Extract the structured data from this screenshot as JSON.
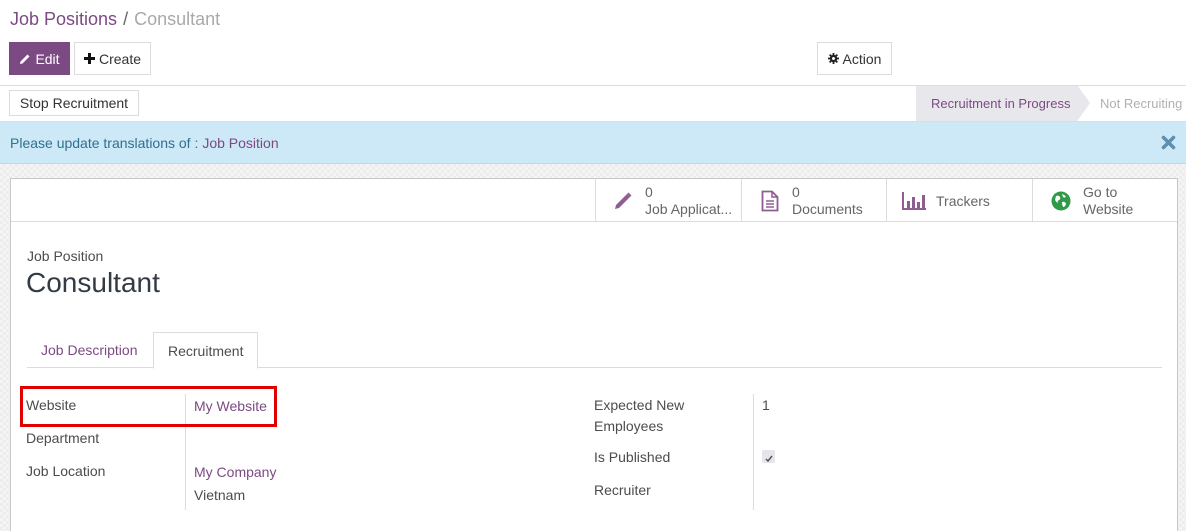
{
  "breadcrumb": {
    "parent": "Job Positions",
    "separator": "/",
    "current": "Consultant"
  },
  "toolbar": {
    "edit_label": "Edit",
    "create_label": "Create",
    "action_label": "Action"
  },
  "statusbar": {
    "stop_label": "Stop Recruitment",
    "stages": [
      {
        "label": "Recruitment in Progress",
        "active": true
      },
      {
        "label": "Not Recruiting",
        "active": false
      }
    ]
  },
  "alert": {
    "text": "Please update translations of :",
    "link": "Job Position"
  },
  "smart_buttons": [
    {
      "icon": "pencil-icon",
      "value": "0",
      "label": "Job Applicat..."
    },
    {
      "icon": "document-icon",
      "value": "0",
      "label": "Documents"
    },
    {
      "icon": "bar-chart-icon",
      "label": "Trackers"
    },
    {
      "icon": "globe-icon",
      "line1": "Go to",
      "line2": "Website"
    }
  ],
  "record": {
    "label": "Job Position",
    "name": "Consultant"
  },
  "tabs": [
    {
      "label": "Job Description",
      "active": false
    },
    {
      "label": "Recruitment",
      "active": true
    }
  ],
  "fields_left": {
    "website": {
      "label": "Website",
      "value": "My Website"
    },
    "department": {
      "label": "Department",
      "value": ""
    },
    "job_location": {
      "label": "Job Location",
      "value_line1": "My Company",
      "value_line2": "Vietnam"
    }
  },
  "fields_right": {
    "expected": {
      "label_line1": "Expected New",
      "label_line2": "Employees",
      "value": "1"
    },
    "published": {
      "label": "Is Published",
      "checked": true
    },
    "recruiter": {
      "label": "Recruiter",
      "value": ""
    }
  },
  "colors": {
    "brand": "#7c4a82",
    "alert_bg": "#cde8f6",
    "highlight": "#e10000",
    "globe": "#28a745"
  }
}
